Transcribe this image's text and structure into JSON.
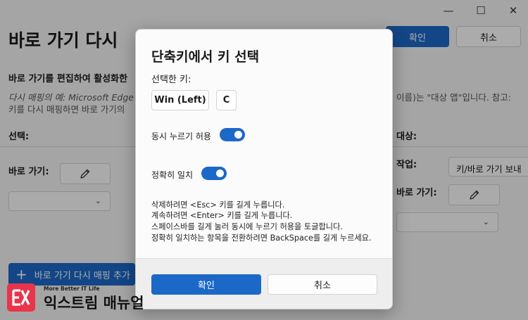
{
  "window": {
    "minimize": "—",
    "maximize": "☐",
    "close": "✕"
  },
  "background": {
    "title": "바로 가기 다시",
    "ok_button": "확인",
    "cancel_button": "취소",
    "description_title": "바로 가기를 편집하여 활성화한",
    "note_line1": "다시 매핑의 예: Microsoft Edge",
    "note_line1_right": "이름)는 \"대상 앱\"입니다. 참고:",
    "note_line2": "키를 다시 매핑하면 바로 가기의",
    "select_label": "선택:",
    "target_label": "대상:",
    "shortcut_label_left": "바로 가기:",
    "action_label": "작업:",
    "action_value": "키/바로 가기 보내",
    "shortcut_label_right": "바로 가기:",
    "add_button": "바로 가기 다시 매핑 추가"
  },
  "dialog": {
    "title": "단축키에서 키 선택",
    "selected_keys_label": "선택한 키:",
    "keys": [
      "Win (Left)",
      "C"
    ],
    "toggle_simultaneous_label": "동시 누르기 허용",
    "toggle_exact_label": "정확히 일치",
    "hints": [
      "삭제하려면 <Esc> 키를 길게 누릅니다.",
      "계속하려면 <Enter> 키를 길게 누릅니다.",
      "스페이스바를 길게 눌러 동시에 누르기 허용을 토글합니다.",
      "정확히 일치하는 항목을 전환하려면 BackSpace를 길게 누르세요."
    ],
    "ok_button": "확인",
    "cancel_button": "취소"
  },
  "watermark": {
    "mark": "EX",
    "tagline": "More Better IT Life",
    "name": "익스트림 매뉴얼"
  },
  "colors": {
    "accent": "#1c68c8",
    "logo_red": "#e8354a"
  },
  "icons": [
    "pencil-icon",
    "chevron-down-icon",
    "plus-icon"
  ]
}
